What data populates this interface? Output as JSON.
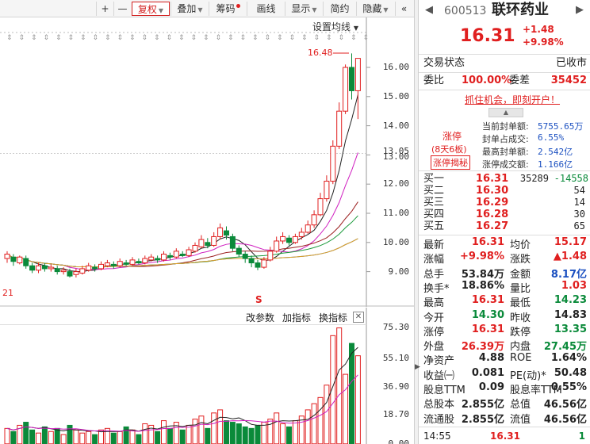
{
  "toolbar": {
    "plus": "+",
    "minus": "—",
    "fuquan": "复权",
    "diejia": "叠加",
    "chouma": "筹码",
    "huaxian": "画线",
    "xianshi": "显示",
    "jianyue": "简约",
    "yincang": "隐藏",
    "nav_left": "«"
  },
  "chart": {
    "ma_settings": "设置均线",
    "high_marker": "16.48",
    "left_low_label": "21",
    "s_marker": "S",
    "price_axis": [
      "16.00",
      "15.00",
      "14.00",
      "13.05",
      "13.00",
      "12.00",
      "11.00",
      "10.00",
      "9.00"
    ],
    "vol_axis": [
      "75.30",
      "55.10",
      "36.90",
      "18.70",
      "0.00"
    ],
    "indicator_buttons": [
      "改参数",
      "加指标",
      "换指标"
    ],
    "close_icon": "✕"
  },
  "panel": {
    "code": "600513",
    "name": "联环药业",
    "price": "16.31",
    "change": "+1.48",
    "change_pct": "+9.98%",
    "trade_status_label": "交易状态",
    "trade_status_value": "已收市",
    "weibi_label": "委比",
    "weibi_value": "100.00%",
    "weicha_label": "委差",
    "weicha_value": "35452",
    "promo": "抓住机会，即刻开户！",
    "limit_up": "涨停",
    "limit_streak": "(8天6板)",
    "limit_reveal": "涨停揭秘",
    "seal": [
      {
        "label": "当前封单额:",
        "value": "5755.65万"
      },
      {
        "label": "封单占成交:",
        "value": "6.55%"
      },
      {
        "label": "最高封单额:",
        "value": "2.542亿"
      },
      {
        "label": "涨停成交额:",
        "value": "1.166亿"
      }
    ],
    "bids": [
      {
        "label": "买一",
        "price": "16.31",
        "vol": "35289",
        "delta": "-14558"
      },
      {
        "label": "买二",
        "price": "16.30",
        "vol": "54",
        "delta": ""
      },
      {
        "label": "买三",
        "price": "16.29",
        "vol": "14",
        "delta": ""
      },
      {
        "label": "买四",
        "price": "16.28",
        "vol": "30",
        "delta": ""
      },
      {
        "label": "买五",
        "price": "16.27",
        "vol": "65",
        "delta": ""
      }
    ],
    "stats": [
      {
        "l1": "最新",
        "v1": "16.31",
        "c1": "red",
        "l2": "均价",
        "v2": "15.17",
        "c2": "red"
      },
      {
        "l1": "涨幅",
        "v1": "+9.98%",
        "c1": "red",
        "l2": "涨跌",
        "v2": "▲1.48",
        "c2": "red"
      },
      {
        "l1": "总手",
        "v1": "53.84万",
        "c1": "",
        "l2": "金额",
        "v2": "8.17亿",
        "c2": "blue"
      },
      {
        "l1": "换手*",
        "v1": "18.86%",
        "c1": "",
        "l2": "量比",
        "v2": "1.03",
        "c2": "red"
      },
      {
        "l1": "最高",
        "v1": "16.31",
        "c1": "red",
        "l2": "最低",
        "v2": "14.23",
        "c2": "green"
      },
      {
        "l1": "今开",
        "v1": "14.30",
        "c1": "green",
        "l2": "昨收",
        "v2": "14.83",
        "c2": ""
      },
      {
        "l1": "涨停",
        "v1": "16.31",
        "c1": "red",
        "l2": "跌停",
        "v2": "13.35",
        "c2": "green"
      },
      {
        "l1": "外盘",
        "v1": "26.39万",
        "c1": "red",
        "l2": "内盘",
        "v2": "27.45万",
        "c2": "green"
      },
      {
        "l1": "净资产",
        "v1": "4.88",
        "c1": "",
        "l2": "ROE",
        "v2": "1.64%",
        "c2": ""
      },
      {
        "l1": "收益㈠",
        "v1": "0.081",
        "c1": "",
        "l2": "PE(动)*",
        "v2": "50.48",
        "c2": ""
      },
      {
        "l1": "股息TTM",
        "v1": "0.09",
        "c1": "",
        "l2": "股息率TTM",
        "v2": "0.55%",
        "c2": ""
      },
      {
        "l1": "总股本",
        "v1": "2.855亿",
        "c1": "",
        "l2": "总值",
        "v2": "46.56亿",
        "c2": ""
      },
      {
        "l1": "流通股",
        "v1": "2.855亿",
        "c1": "",
        "l2": "流值",
        "v2": "46.56亿",
        "c2": ""
      }
    ],
    "tick": {
      "time": "14:55",
      "price": "16.31",
      "vol": "1"
    }
  }
}
